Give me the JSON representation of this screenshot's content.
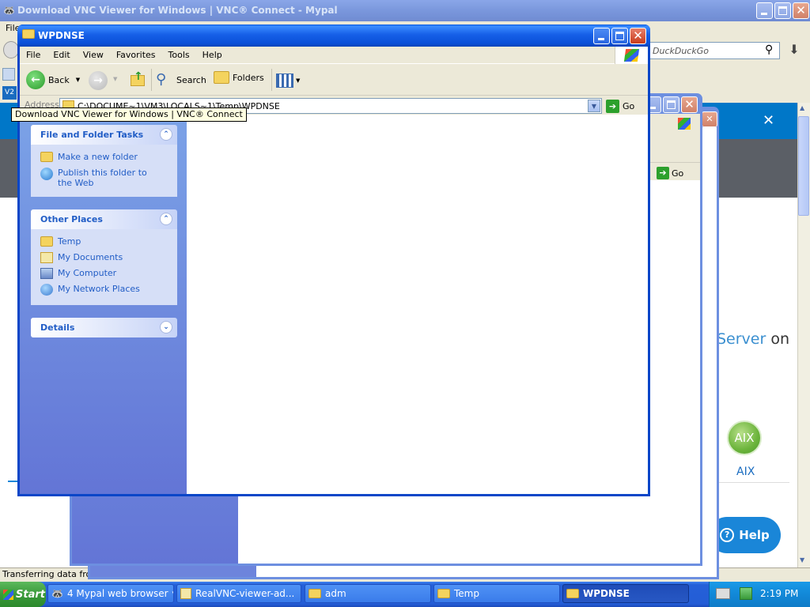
{
  "mypal": {
    "title": "Download VNC Viewer for Windows | VNC® Connect - Mypal",
    "menu_fragment": "File",
    "search_placeholder": "DuckDuckGo",
    "server_text": "Server",
    "server_suffix": "on",
    "aix_label": "AIX",
    "aix_badge": "AIX",
    "help_label": "Help",
    "status_text": "Transferring data from"
  },
  "explorer": {
    "title": "WPDNSE",
    "menu": [
      "File",
      "Edit",
      "View",
      "Favorites",
      "Tools",
      "Help"
    ],
    "toolbar": {
      "back": "Back",
      "search": "Search",
      "folders": "Folders"
    },
    "address_label": "Address",
    "address_value": "C:\\DOCUME~1\\VM3\\LOCALS~1\\Temp\\WPDNSE",
    "go_label": "Go",
    "tooltip": "Download VNC Viewer for Windows | VNC® Connect",
    "panels": {
      "tasks": {
        "title": "File and Folder Tasks",
        "items": [
          "Make a new folder",
          "Publish this folder to the Web"
        ]
      },
      "places": {
        "title": "Other Places",
        "items": [
          "Temp",
          "My Documents",
          "My Computer",
          "My Network Places"
        ]
      },
      "details": {
        "title": "Details"
      }
    }
  },
  "back_explorer": {
    "go_label": "Go"
  },
  "taskbar": {
    "start": "Start",
    "tasks": [
      {
        "label": "4 Mypal web browser"
      },
      {
        "label": "RealVNC-viewer-ad..."
      },
      {
        "label": "adm"
      },
      {
        "label": "Temp"
      },
      {
        "label": "WPDNSE"
      }
    ],
    "clock": "2:19 PM"
  },
  "colors": {
    "xp_blue": "#0a46c8",
    "task_pane": "#6375d6",
    "link_blue": "#215dc6",
    "start_green": "#3a9a3a",
    "vnc_blue": "#0077c8"
  }
}
